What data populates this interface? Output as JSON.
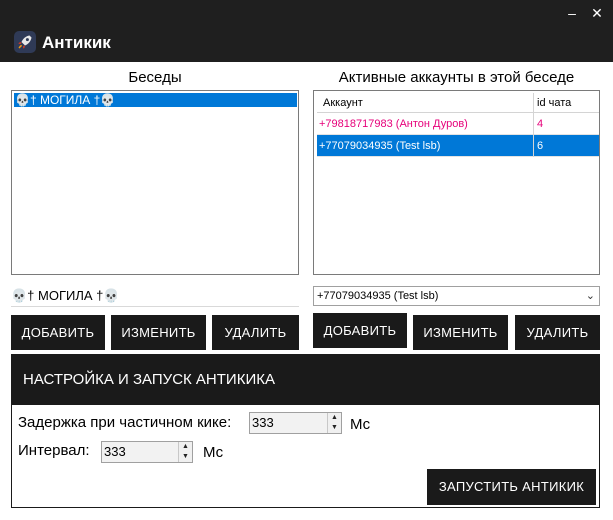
{
  "window": {
    "title": "Антикик",
    "minimize_glyph": "–",
    "close_glyph": "✕",
    "icon": "rocket-icon"
  },
  "chats": {
    "title": "Беседы",
    "items": [
      "💀† МОГИЛА †💀"
    ],
    "selected_name": "💀† МОГИЛА †💀",
    "add_label": "ДОБАВИТЬ",
    "edit_label": "ИЗМЕНИТЬ",
    "delete_label": "УДАЛИТЬ"
  },
  "accounts": {
    "title": "Активные аккаунты в этой беседе",
    "columns": [
      "Аккаунт",
      "id чата"
    ],
    "rows": [
      {
        "account": "+79818717983 (Антон Дуров)",
        "chat_id": "4",
        "color": "#e6007a"
      },
      {
        "account": "+77079034935 (Test lsb)",
        "chat_id": "6",
        "selected": true
      }
    ],
    "selected_account": "+77079034935 (Test lsb)",
    "add_label": "ДОБАВИТЬ",
    "edit_label": "ИЗМЕНИТЬ",
    "delete_label": "УДАЛИТЬ"
  },
  "settings": {
    "title": "НАСТРОЙКА И ЗАПУСК АНТИКИКА",
    "delay_label": "Задержка при частичном кике:",
    "delay_value": "333",
    "delay_unit": "Мс",
    "interval_label": "Интервал:",
    "interval_value": "333",
    "interval_unit": "Мс",
    "start_label": "ЗАПУСТИТЬ АНТИКИК"
  },
  "colors": {
    "titlebar": "#1f1f1f",
    "button": "#1a1a1a",
    "selection": "#0078d7",
    "highlight_text": "#e6007a"
  }
}
